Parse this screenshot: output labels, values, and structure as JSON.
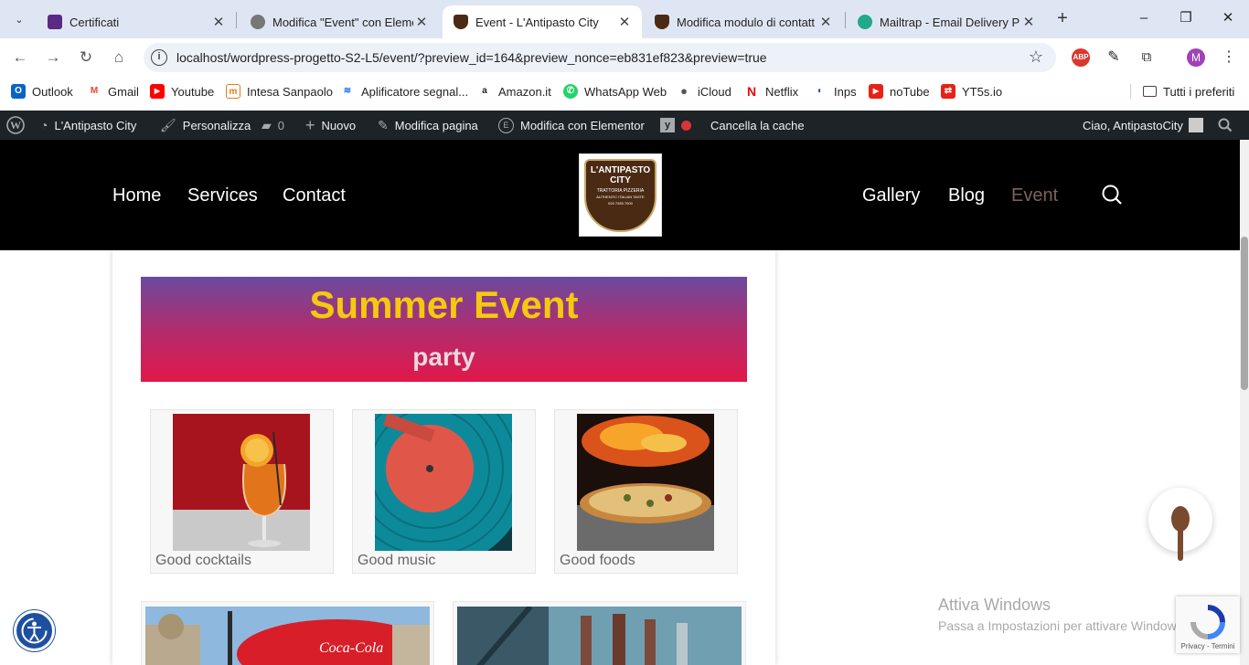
{
  "browser": {
    "tabs": [
      {
        "title": "Certificati",
        "fav_color": "#5b2a86"
      },
      {
        "title": "Modifica \"Event\" con Eleme",
        "fav_color": "#666666"
      },
      {
        "title": "Event - L'Antipasto City",
        "fav_color": "#4b2a14"
      },
      {
        "title": "Modifica modulo di contatt",
        "fav_color": "#4b2a14"
      },
      {
        "title": "Mailtrap - Email Delivery Pl",
        "fav_color": "#22a88a"
      }
    ],
    "active_tab": 2,
    "url": "localhost/wordpress-progetto-S2-L5/event/?preview_id=164&preview_nonce=eb831ef823&preview=true",
    "profile_initial": "M",
    "ext_abp": "ABP"
  },
  "bookmarks": [
    {
      "label": "Outlook",
      "icon": "outlook-icon",
      "color": "#0a64c8",
      "glyph": "O"
    },
    {
      "label": "Gmail",
      "icon": "gmail-icon",
      "color": "#ea4335",
      "glyph": "M"
    },
    {
      "label": "Youtube",
      "icon": "youtube-icon",
      "color": "#ff0000",
      "glyph": "▶"
    },
    {
      "label": "Intesa Sanpaolo",
      "icon": "bank-icon",
      "color": "#e07b1a",
      "glyph": "m"
    },
    {
      "label": "Aplificatore segnal...",
      "icon": "wifi-icon",
      "color": "#1a73e8",
      "glyph": "≋"
    },
    {
      "label": "Amazon.it",
      "icon": "amazon-icon",
      "color": "#222222",
      "glyph": "a"
    },
    {
      "label": "WhatsApp Web",
      "icon": "whatsapp-icon",
      "color": "#25d366",
      "glyph": "✆"
    },
    {
      "label": "iCloud",
      "icon": "apple-icon",
      "color": "#555555",
      "glyph": ""
    },
    {
      "label": "Netflix",
      "icon": "netflix-icon",
      "color": "#e50914",
      "glyph": "N"
    },
    {
      "label": "Inps",
      "icon": "inps-icon",
      "color": "#1f4ea3",
      "glyph": "◐"
    },
    {
      "label": "noTube",
      "icon": "notube-icon",
      "color": "#e62117",
      "glyph": "▶"
    },
    {
      "label": "YT5s.io",
      "icon": "yt5s-icon",
      "color": "#e62117",
      "glyph": "⇄"
    }
  ],
  "bookmarks_folder": "Tutti i preferiti",
  "adminbar": {
    "site": "L'Antipasto City",
    "customize": "Personalizza",
    "comments": "0",
    "new": "Nuovo",
    "edit_page": "Modifica pagina",
    "elementor": "Modifica con Elementor",
    "clear_cache": "Cancella la cache",
    "greeting": "Ciao, AntipastoCity"
  },
  "site": {
    "nav_left": [
      "Home",
      "Services",
      "Contact"
    ],
    "nav_right": [
      "Gallery",
      "Blog",
      "Event"
    ],
    "logo_line1": "L'ANTIPASTO",
    "logo_line2": "CITY",
    "logo_line3": "TRATTORIA PIZZERIA",
    "logo_line4": "AUTHENTIC ITALIAN TASTE",
    "logo_line5": "020 7283 7000"
  },
  "event": {
    "title": "Summer Event",
    "subtitle": "party",
    "cards": [
      "Good cocktails",
      "Good music",
      "Good foods"
    ]
  },
  "overlay": {
    "watermark_title": "Attiva Windows",
    "watermark_sub": "Passa a Impostazioni per attivare Windows.",
    "recaptcha": "Privacy - Termini"
  },
  "colors": {
    "accent_current": "#7d6358",
    "banner_title": "#f6c90e",
    "admin_bar": "#1d2327"
  }
}
